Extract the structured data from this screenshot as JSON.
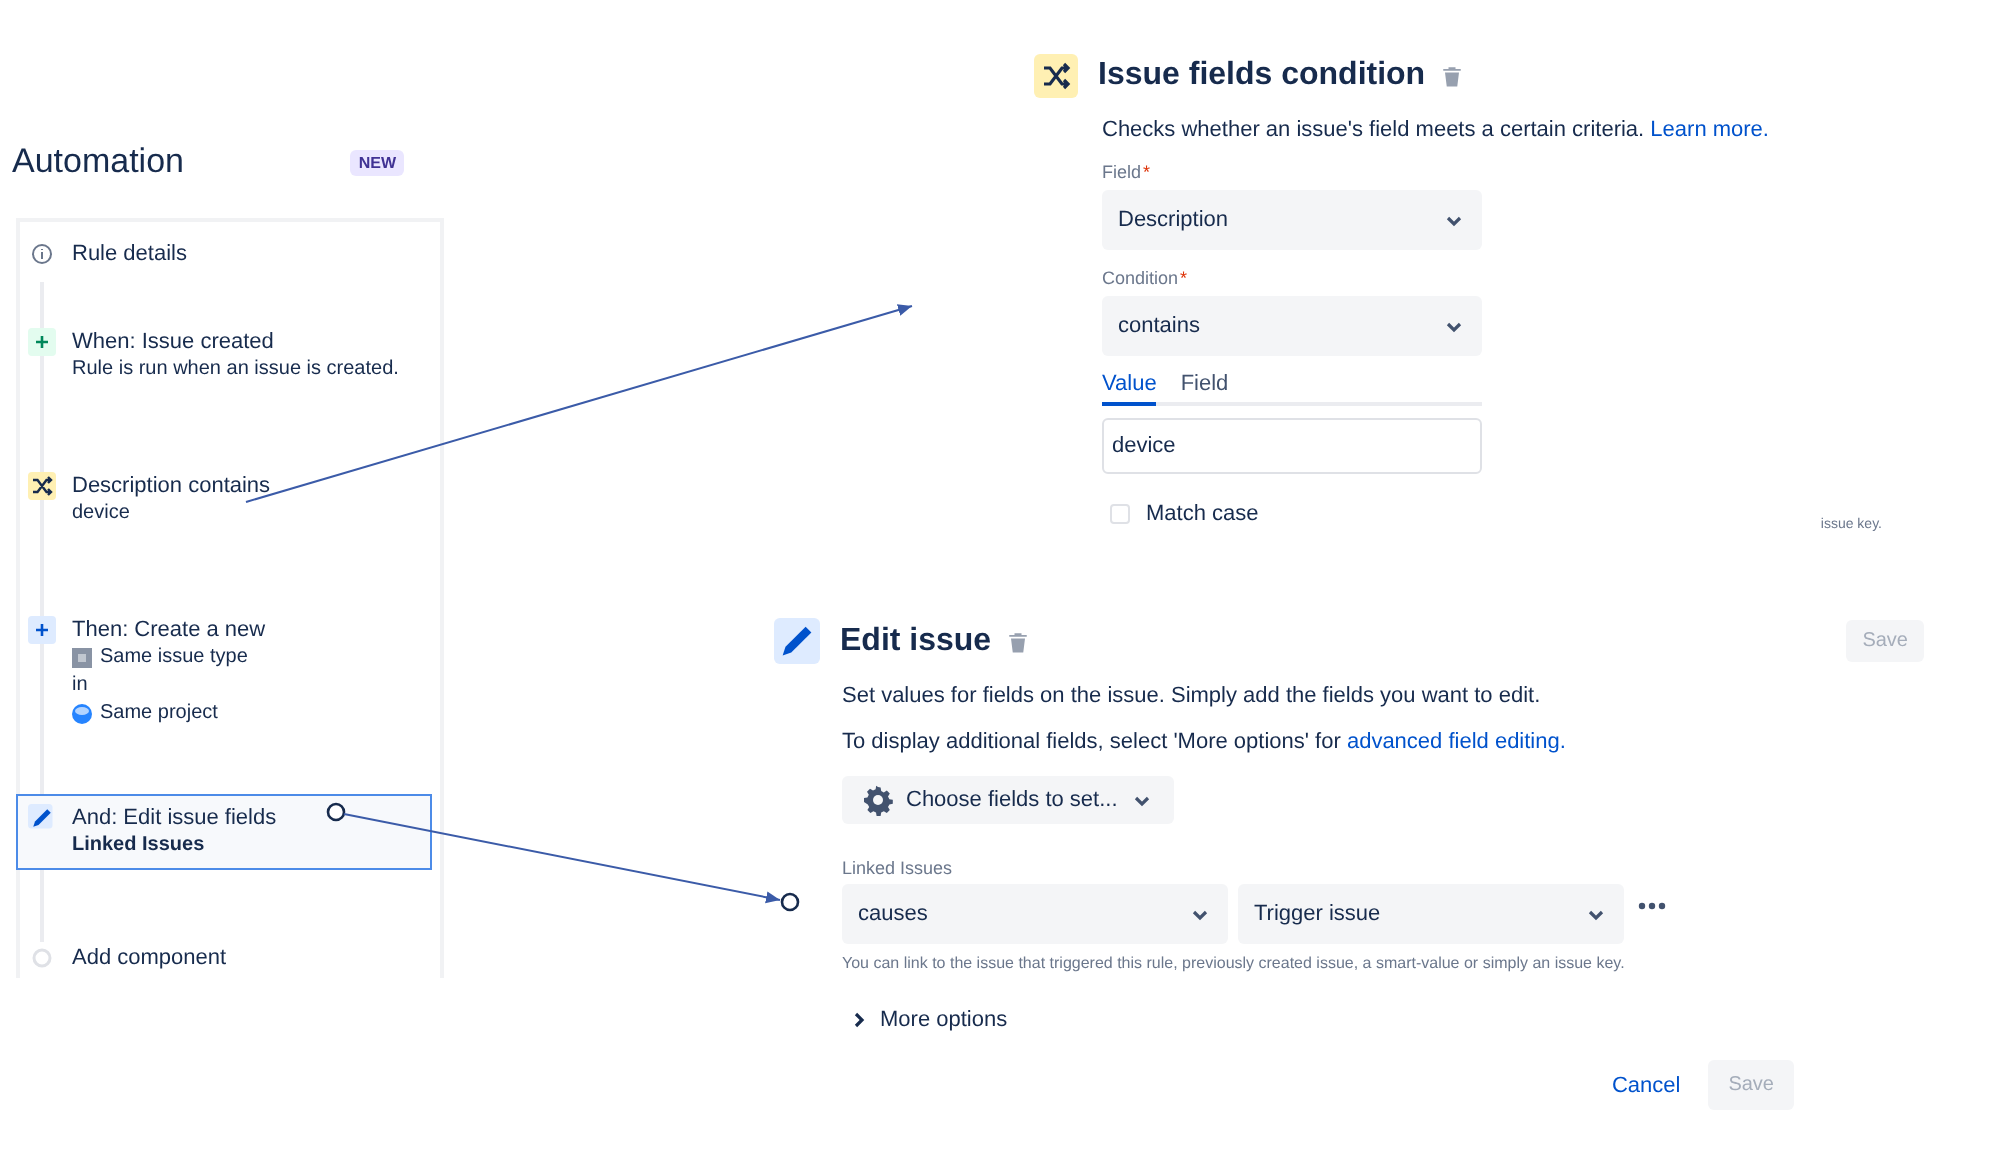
{
  "sidebar": {
    "title": "Automation",
    "badge": "NEW",
    "items": [
      {
        "kind": "info",
        "title": "Rule details",
        "selected": false
      },
      {
        "kind": "trigger",
        "title": "When: Issue created",
        "selected": false,
        "lines": [
          {
            "kind": "plain",
            "text": "Rule is run when an issue is created."
          }
        ]
      },
      {
        "kind": "condition",
        "title": "Description contains",
        "selected": false,
        "lines": [
          {
            "kind": "plain",
            "text": "device"
          }
        ]
      },
      {
        "kind": "action",
        "title": "Then: Create a new",
        "selected": false,
        "lines": [
          {
            "kind": "issue-type",
            "text": "Same issue type"
          },
          {
            "kind": "plain",
            "text": "in"
          },
          {
            "kind": "project",
            "text": "Same project"
          }
        ]
      },
      {
        "kind": "edit",
        "title": "And: Edit issue fields",
        "selected": true,
        "lines": [
          {
            "kind": "strong",
            "text": "Linked Issues"
          }
        ]
      },
      {
        "kind": "add",
        "title": "Add component",
        "selected": false
      }
    ]
  },
  "condition_panel": {
    "title": "Issue fields condition",
    "description": "Checks whether an issue's field meets a certain criteria.",
    "link": "Learn more.",
    "fields": [
      {
        "label": "Field",
        "required_mark": "*",
        "value": "Description"
      },
      {
        "label": "Condition",
        "required_mark": "*",
        "value": "contains"
      }
    ],
    "tabs": [
      {
        "label": "Value",
        "selected": true
      },
      {
        "label": "Field",
        "selected": false
      }
    ],
    "value": "device",
    "checkbox": {
      "label": "Match case",
      "checked": false
    },
    "side_note": "issue key."
  },
  "edit_panel": {
    "title": "Edit issue",
    "top_save": {
      "label": "Save",
      "disabled": true
    },
    "paragraphs": [
      {
        "text": "Set values for fields on the issue. Simply add the fields you want to edit."
      },
      {
        "text": "To display additional fields, select 'More options' for ",
        "link": "advanced field editing."
      }
    ],
    "choose_button": "Choose fields to set...",
    "linked_label": "Linked Issues",
    "selects": [
      "causes",
      "Trigger issue"
    ],
    "helper": "You can link to the issue that triggered this rule, previously created issue, a smart-value or simply an issue key.",
    "more_options": "More options",
    "cancel": "Cancel",
    "save": {
      "label": "Save",
      "disabled": true
    }
  }
}
